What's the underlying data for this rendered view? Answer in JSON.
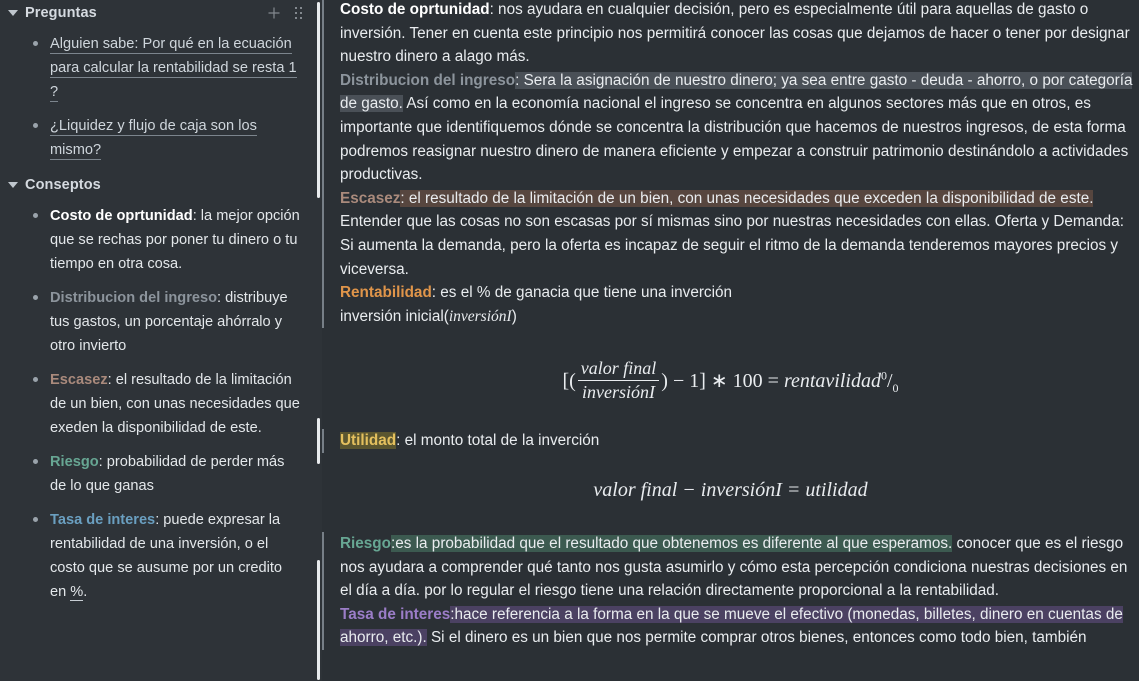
{
  "sidebar": {
    "add_icon": "plus-icon",
    "grid_icon": "grid-dots-icon",
    "groups": [
      {
        "title": "Preguntas",
        "items": [
          "Alguien sabe: Por qué en la ecuación para calcular la rentabilidad se resta 1 ?",
          "¿Liquidez y flujo de caja son los mismo?"
        ]
      },
      {
        "title": "Conseptos",
        "items": [
          {
            "term": "Costo de oprtunidad",
            "rest": ": la mejor opción que se rechas por poner tu dinero o tu tiempo en otra cosa."
          },
          {
            "term": "Distribucion del ingreso",
            "rest": ": distribuye tus gastos, un porcentaje ahórralo y otro invierto"
          },
          {
            "term": "Escasez",
            "rest": ": el resultado de la limitación de un bien, con unas necesidades que exeden la disponibilidad de este."
          },
          {
            "term": "Riesgo",
            "rest": ": probabilidad de perder más de lo que ganas"
          },
          {
            "term": "Tasa de interes",
            "rest": ": puede expresar la rentabilidad de una inversión, o el costo que se ausume por un credito en ",
            "tail": "%",
            "tail_suffix": "."
          }
        ]
      }
    ]
  },
  "main": {
    "block1": {
      "p1_term": "Costo de oprtunidad",
      "p1_text": ": nos ayudara en cualquier decisión, pero es especialmente útil para aquellas de gasto o inversión. Tener en cuenta este principio nos permitirá conocer las cosas que dejamos de hacer o tener por designar nuestro dinero a alago más.",
      "p2_term": "Distribucion del ingreso",
      "p2_hl": ": Sera la asignación de nuestro dinero; ya sea entre gasto - deuda - ahorro, o por categoría de gasto.",
      "p2_rest": " Así como en la economía nacional el ingreso se concentra en algunos sectores más que en otros, es importante que identifiquemos dónde se concentra la distribución que hacemos de nuestros ingresos, de esta forma podremos reasignar nuestro dinero de manera eficiente y empezar a construir patrimonio destinándolo a actividades productivas.",
      "p3_term": "Escasez",
      "p3_hl": ": el resultado de la limitación de un bien, con unas necesidades que exceden la disponibilidad de este.",
      "p3_rest": " Entender que las cosas no son escasas por sí mismas sino por nuestras necesidades con ellas. Oferta y Demanda: Si aumenta la demanda, pero la oferta es incapaz de seguir el ritmo de la demanda tenderemos mayores precios y viceversa.",
      "p4_term": "Rentabilidad",
      "p4_text": ": es el % de ganacia que tiene una inverción",
      "p5_text": "inversión inicial(",
      "p5_math": "inversiónI",
      "p5_tail": ")"
    },
    "formula1": {
      "lbracket": "[(",
      "numerator": "valor final",
      "denominator": "inversiónI",
      "after_paren": ") − 1] ∗ 100 =",
      "result": "rentavilidad",
      "sup": "0",
      "slash": "/",
      "sub": "0"
    },
    "block2": {
      "term": "Utilidad",
      "text": ": el monto total de la inverción"
    },
    "formula2": {
      "text": "valor final − inversiónI = utilidad"
    },
    "block3": {
      "p1_term": "Riesgo",
      "p1_hl": ":es la probabilidad que el resultado que obtenemos es diferente al que esperamos.",
      "p1_rest": " conocer que es el riesgo nos ayudara a comprender qué tanto nos gusta asumirlo y cómo esta percepción condiciona nuestras decisiones en el día a día. por lo regular el riesgo tiene una relación directamente proporcional a la rentabilidad.",
      "p2_term": "Tasa de interes",
      "p2_hl": ":hace referencia a la forma en la que se mueve el efectivo (monedas, billetes, dinero en cuentas de ahorro, etc.).",
      "p2_rest": " Si el dinero es un bien que nos permite comprar otros bienes, entonces como todo bien, también"
    }
  },
  "colors": {
    "background": "#2b3035",
    "sidebar_bg": "#2e3338",
    "text": "#e9ecef",
    "accent_orange": "#e0954a",
    "accent_yellow": "#e4c05e",
    "accent_green": "#67a693",
    "accent_blue": "#6a9fc0",
    "accent_purple": "#9b7dc7",
    "accent_brown": "#a98a7c"
  }
}
